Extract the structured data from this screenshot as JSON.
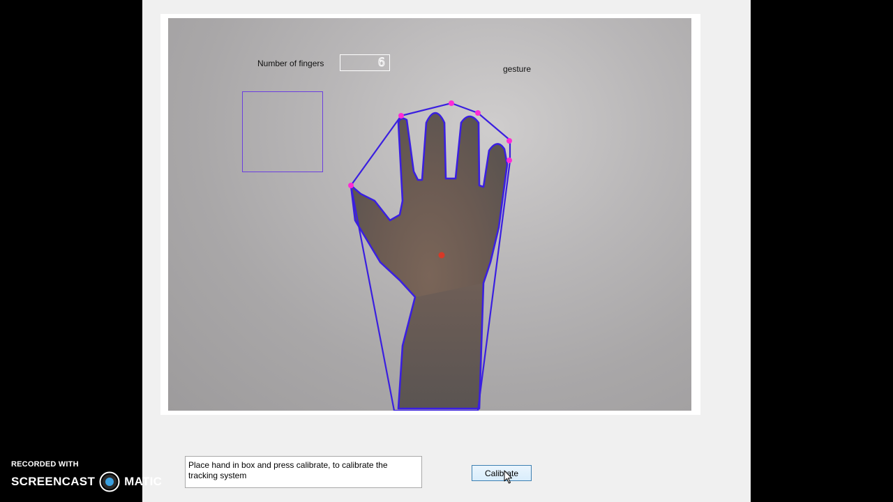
{
  "overlay": {
    "finger_count_label": "Number of fingers",
    "finger_count_value": "6",
    "gesture_label": "gesture"
  },
  "controls": {
    "instruction_text": "Place hand in box and press calibrate, to calibrate the tracking system",
    "calibrate_label": "Calibrate"
  },
  "watermark": {
    "recorded_with": "RECORDED WITH",
    "brand_left": "SCREENCAST",
    "brand_right": "MATIC"
  },
  "colors": {
    "contour": "#3a1fe0",
    "fingertip_marker": "#ff2bd6",
    "palm_center_marker": "#e8321e",
    "calibration_box": "#6a3ee0"
  },
  "icons": {
    "cursor": "arrow-cursor-icon",
    "logo": "screencast-o-matic-logo"
  }
}
